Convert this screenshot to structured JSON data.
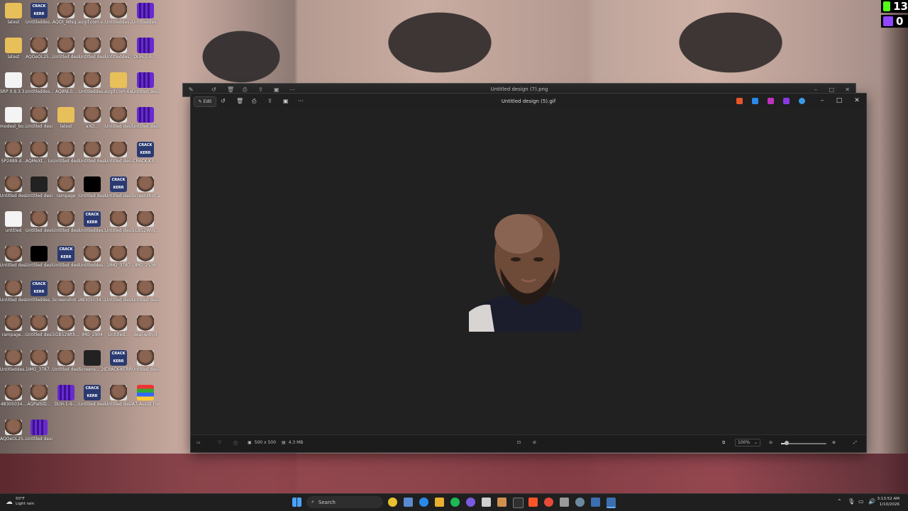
{
  "badges": [
    {
      "count": "13",
      "color": "#53fc18"
    },
    {
      "count": "0",
      "color": "#9146ff"
    }
  ],
  "desktop_icons": [
    {
      "label": "latest",
      "type": "folder"
    },
    {
      "label": "Untitleddes...",
      "type": "crack",
      "text": "CRACK KERR"
    },
    {
      "label": "AQOt_Wlsq...",
      "type": "face"
    },
    {
      "label": "ezgif.com-v...",
      "type": "face"
    },
    {
      "label": "Untitleddes...",
      "type": "face"
    },
    {
      "label": "Untitleddes...",
      "type": "purple"
    },
    {
      "label": "latest",
      "type": "folder"
    },
    {
      "label": "AQOeOL25...",
      "type": "face"
    },
    {
      "label": "Untitled design",
      "type": "face"
    },
    {
      "label": "Untitled design (8)",
      "type": "face"
    },
    {
      "label": "Untitleddes...",
      "type": "face"
    },
    {
      "label": "DUH-1-9-...",
      "type": "purple"
    },
    {
      "label": "SRP 0.9.3.3.z",
      "type": "doc"
    },
    {
      "label": "Untitleddes...",
      "type": "face"
    },
    {
      "label": "AQ8NL0...",
      "type": "face"
    },
    {
      "label": "Untitleddes...",
      "type": "face"
    },
    {
      "label": "ezgif.com-6x",
      "type": "folder"
    },
    {
      "label": "Untitled design (12)",
      "type": "purple"
    },
    {
      "label": "modest_bo...",
      "type": "doc"
    },
    {
      "label": "Untitled design",
      "type": "face"
    },
    {
      "label": "latest",
      "type": "folder"
    },
    {
      "label": "aXD...",
      "type": "face"
    },
    {
      "label": "Untitled design",
      "type": "face"
    },
    {
      "label": "Untitled design",
      "type": "purple"
    },
    {
      "label": "SP2489-d...",
      "type": "face"
    },
    {
      "label": "AQMeXt... (online)",
      "type": "face"
    },
    {
      "label": "Untitled design",
      "type": "face"
    },
    {
      "label": "Untitled design (7)",
      "type": "face"
    },
    {
      "label": "Untitled design",
      "type": "face"
    },
    {
      "label": "CRACK-K3...",
      "type": "crack",
      "text": "CRACK KERR"
    },
    {
      "label": "Untitled design (3)",
      "type": "face"
    },
    {
      "label": "Untitled design",
      "type": "dark"
    },
    {
      "label": "rampage",
      "type": "face"
    },
    {
      "label": "Untitled design",
      "type": "black"
    },
    {
      "label": "Untitled design",
      "type": "crack",
      "text": "CRACK KERR"
    },
    {
      "label": "Screenshot 2026-01-...",
      "type": "face"
    },
    {
      "label": "untitled",
      "type": "doc"
    },
    {
      "label": "Untitled design",
      "type": "face"
    },
    {
      "label": "Untitled design",
      "type": "face"
    },
    {
      "label": "Untitleddes...",
      "type": "crack",
      "text": "CRACK KERR"
    },
    {
      "label": "Untitled design (8)",
      "type": "face"
    },
    {
      "label": "1GB52Wth...",
      "type": "face"
    },
    {
      "label": "Untitled design (9)",
      "type": "face"
    },
    {
      "label": "Untitled design (10)",
      "type": "black"
    },
    {
      "label": "Untitled design (1)",
      "type": "crack",
      "text": "CRACK KERR"
    },
    {
      "label": "Untitleddes...",
      "type": "face"
    },
    {
      "label": "1IMG_3787",
      "type": "face"
    },
    {
      "label": "IMG_2536",
      "type": "face"
    },
    {
      "label": "Untitled design (11)",
      "type": "face"
    },
    {
      "label": "Untitleddes...",
      "type": "crack",
      "text": "CRACK KERR"
    },
    {
      "label": "Screenshot 2026-01-...",
      "type": "face"
    },
    {
      "label": "48305034...",
      "type": "face"
    },
    {
      "label": "Untitled design (10)",
      "type": "face"
    },
    {
      "label": "Untitled design (6)",
      "type": "face"
    },
    {
      "label": "rampage...",
      "type": "face"
    },
    {
      "label": "Untitled design (4)",
      "type": "face"
    },
    {
      "label": "1GB52Wth...",
      "type": "face"
    },
    {
      "label": "IMG_2904",
      "type": "face"
    },
    {
      "label": "Untitled...",
      "type": "face"
    },
    {
      "label": "deal-with-it",
      "type": "face"
    },
    {
      "label": "Untitleddes...",
      "type": "face"
    },
    {
      "label": "1IMG_3787...",
      "type": "face"
    },
    {
      "label": "Untitled design (5)",
      "type": "face"
    },
    {
      "label": "Screens... 2026-0...",
      "type": "dark"
    },
    {
      "label": "CRACK-KERR... (1)",
      "type": "crack",
      "text": "CRACK KERR"
    },
    {
      "label": "Untitled design (5)",
      "type": "face"
    },
    {
      "label": "48305034...",
      "type": "face"
    },
    {
      "label": "AQPalSlD...",
      "type": "face"
    },
    {
      "label": "DUH-1-9-...",
      "type": "purple"
    },
    {
      "label": "Untitled design (2)",
      "type": "crack",
      "text": "CRACK KERR"
    },
    {
      "label": "Untitled design (6)",
      "type": "face"
    },
    {
      "label": "A7-Assist For AC",
      "type": "rar"
    },
    {
      "label": "AQOeOL2S...",
      "type": "face"
    },
    {
      "label": "Untitled design (11)",
      "type": "purple"
    }
  ],
  "back_window": {
    "title": "Untitled design (7).png"
  },
  "photos_window": {
    "title": "Untitled design (5).gif",
    "edit_label": "Edit",
    "more_label": "···",
    "dimensions": "500 x 500",
    "file_size": "4.3 MB",
    "zoom": "100%",
    "zoom_slider_fraction": 0.13,
    "app_colors": [
      "#e8552a",
      "#2a8ae8",
      "#c030c0",
      "#8a3ae0",
      "#3a9ae8"
    ]
  },
  "taskbar": {
    "temperature": "50°F",
    "weather": "Light rain",
    "search_placeholder": "Search",
    "time": "3:13:52 AM",
    "date": "1/10/2026"
  }
}
